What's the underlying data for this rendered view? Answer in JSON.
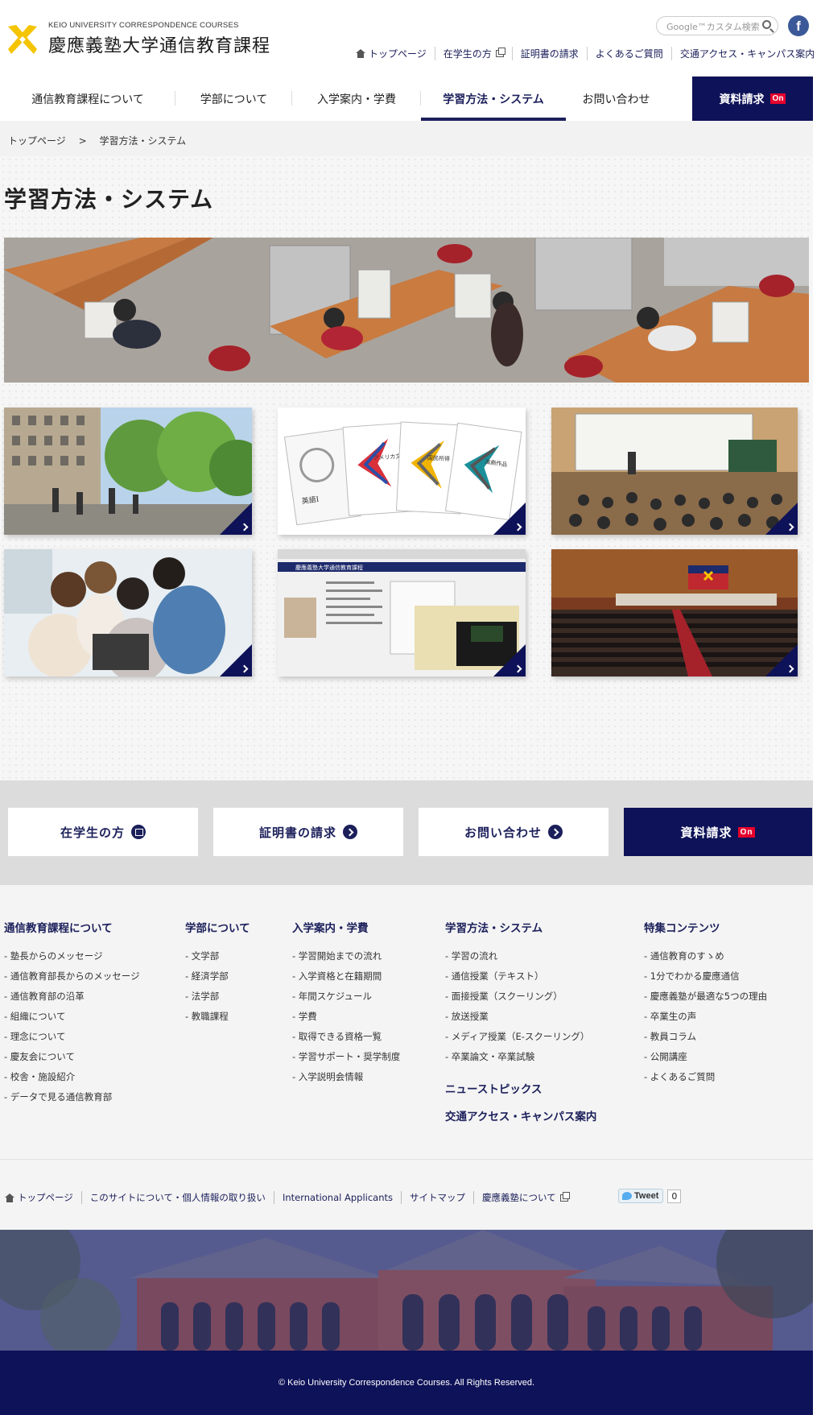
{
  "header": {
    "logo_sub": "KEIO UNIVERSITY CORRESPONDENCE COURSES",
    "logo_main": "慶應義塾大学通信教育課程",
    "search_placeholder": "Google™カスタム検索",
    "facebook_icon": "f",
    "util_nav": [
      {
        "label": "トップページ",
        "icon": "home-icon"
      },
      {
        "label": "在学生の方",
        "icon": "external-link-icon"
      },
      {
        "label": "証明書の請求"
      },
      {
        "label": "よくあるご質問"
      },
      {
        "label": "交通アクセス・キャンパス案内"
      }
    ],
    "main_nav": [
      {
        "label": "通信教育課程について"
      },
      {
        "label": "学部について"
      },
      {
        "label": "入学案内・学費"
      },
      {
        "label": "学習方法・システム",
        "active": true
      },
      {
        "label": "お問い合わせ"
      }
    ],
    "request_label": "資料請求",
    "on_badge": "On"
  },
  "breadcrumb": {
    "home": "トップページ",
    "separator": ">",
    "current": "学習方法・システム"
  },
  "page_title": "学習方法・システム",
  "tiles": [
    {
      "name": "campus-photo",
      "topic": "campus"
    },
    {
      "name": "textbooks-photo",
      "topic": "textbooks",
      "book_titles": [
        "英語Ⅰ",
        "アメリカ文学",
        "国民所得",
        "演劇作品"
      ]
    },
    {
      "name": "lecture-hall-photo",
      "topic": "schooling"
    },
    {
      "name": "students-laptop-photo",
      "topic": "broadcast"
    },
    {
      "name": "e-schooling-screen-photo",
      "topic": "e-schooling",
      "screen_title": "慶應義塾大学通信教育課程"
    },
    {
      "name": "auditorium-photo",
      "topic": "graduation"
    }
  ],
  "cta": [
    {
      "label": "在学生の方",
      "icon": "window-icon"
    },
    {
      "label": "証明書の請求",
      "icon": "arrow-circle-icon"
    },
    {
      "label": "お問い合わせ",
      "icon": "arrow-circle-icon"
    },
    {
      "label": "資料請求",
      "badge": "On"
    }
  ],
  "sitemap": {
    "col1": {
      "head": "通信教育課程について",
      "items": [
        "- 塾長からのメッセージ",
        "- 通信教育部長からのメッセージ",
        "- 通信教育部の沿革",
        "- 組織について",
        "- 理念について",
        "- 慶友会について",
        "- 校舎・施設紹介",
        "- データで見る通信教育部"
      ]
    },
    "col2": {
      "head": "学部について",
      "items": [
        "- 文学部",
        "- 経済学部",
        "- 法学部",
        "- 教職課程"
      ]
    },
    "col3": {
      "head": "入学案内・学費",
      "items": [
        "- 学習開始までの流れ",
        "- 入学資格と在籍期間",
        "- 年間スケジュール",
        "- 学費",
        "- 取得できる資格一覧",
        "- 学習サポート・奨学制度",
        "- 入学説明会情報"
      ]
    },
    "col4": {
      "head": "学習方法・システム",
      "items": [
        "- 学習の流れ",
        "- 通信授業（テキスト）",
        "- 面接授業（スクーリング）",
        "- 放送授業",
        "- メディア授業（E-スクーリング）",
        "- 卒業論文・卒業試験"
      ],
      "extra1": "ニューストピックス",
      "extra2": "交通アクセス・キャンパス案内"
    },
    "col5": {
      "head": "特集コンテンツ",
      "items": [
        "- 通信教育のすゝめ",
        "- 1分でわかる慶應通信",
        "- 慶應義塾が最適な5つの理由",
        "- 卒業生の声",
        "- 教員コラム",
        "- 公開講座",
        "- よくあるご質問"
      ]
    }
  },
  "bottom_links": [
    {
      "label": "トップページ",
      "icon": "home-icon"
    },
    {
      "label": "このサイトについて・個人情報の取り扱い"
    },
    {
      "label": "International Applicants"
    },
    {
      "label": "サイトマップ"
    },
    {
      "label": "慶應義塾について",
      "icon": "external-link-icon"
    }
  ],
  "tweet": {
    "label": "Tweet",
    "count": "0"
  },
  "copyright": "© Keio University Correspondence Courses. All Rights Reserved.",
  "colors": {
    "navy": "#0e1258",
    "accent_red": "#e6002d",
    "logo_yellow": "#f5c400"
  }
}
